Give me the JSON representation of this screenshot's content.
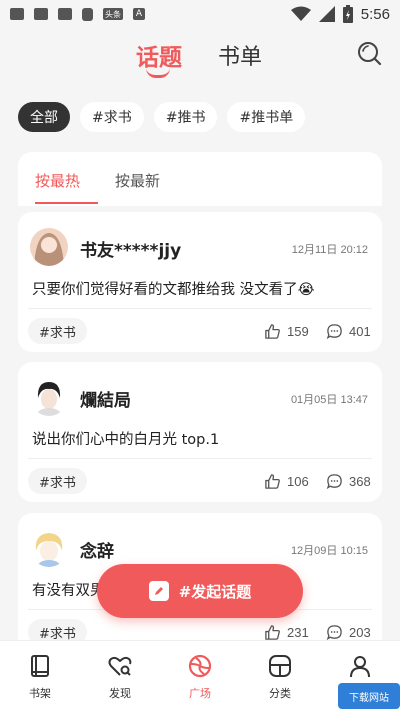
{
  "status_bar": {
    "time": "5:56",
    "news_badge": "头条",
    "letter_badge": "A"
  },
  "header": {
    "tabs": [
      {
        "label": "话题"
      },
      {
        "label": "书单"
      }
    ]
  },
  "filters": [
    {
      "label": "全部"
    },
    {
      "label": "#求书"
    },
    {
      "label": "#推书"
    },
    {
      "label": "#推书单"
    }
  ],
  "sort": {
    "hot": "按最热",
    "new": "按最新"
  },
  "posts": [
    {
      "user": "书友*****jjy",
      "date": "12月11日 20:12",
      "content": "只要你们觉得好看的文都推给我 没文看了😭",
      "tag": "#求书",
      "likes": "159",
      "comments": "401"
    },
    {
      "user": "爛結局",
      "date": "01月05日 13:47",
      "content": "说出你们心中的白月光 top.1",
      "tag": "#求书",
      "likes": "106",
      "comments": "368"
    },
    {
      "user": "念辞",
      "date": "12月09日 10:15",
      "content": "有没有双男",
      "tag": "#求书",
      "likes": "231",
      "comments": "203"
    }
  ],
  "fab": {
    "label": "#发起话题"
  },
  "nav": [
    {
      "label": "书架"
    },
    {
      "label": "发现"
    },
    {
      "label": "广场"
    },
    {
      "label": "分类"
    },
    {
      "label": "我的"
    }
  ],
  "watermark": "下载网站",
  "colors": {
    "accent": "#f05a5a",
    "dark_chip": "#333333"
  }
}
